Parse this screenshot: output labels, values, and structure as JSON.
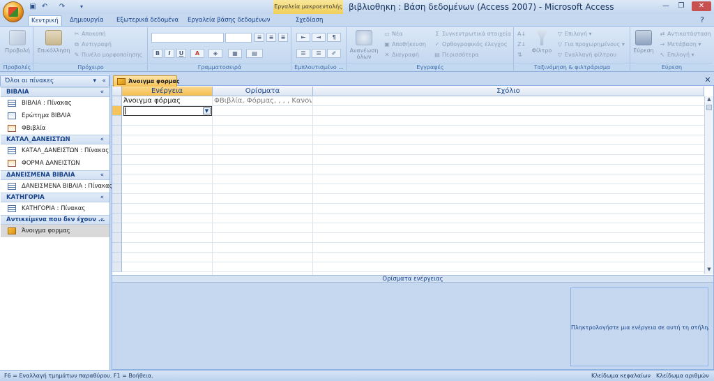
{
  "title_bar": {
    "context_tools": "Εργαλεία μακροεντολής",
    "window_title": "βιβλιοθηκη : Βάση δεδομένων (Access 2007) - Microsoft Access"
  },
  "ribbon_tabs": [
    {
      "label": "Κεντρική",
      "active": true
    },
    {
      "label": "Δημιουργία"
    },
    {
      "label": "Εξωτερικά δεδομένα"
    },
    {
      "label": "Εργαλεία βάσης δεδομένων"
    },
    {
      "label": "Σχεδίαση",
      "contextual": true
    }
  ],
  "ribbon": {
    "views": {
      "label": "Προβολές",
      "view_button": "Προβολή"
    },
    "clipboard": {
      "label": "Πρόχειρο",
      "paste": "Επικόλληση",
      "cut": "Αποκοπή",
      "copy": "Αντιγραφή",
      "format_painter": "Πινέλο μορφοποίησης"
    },
    "font": {
      "label": "Γραμματοσειρά",
      "bold": "B",
      "italic": "I",
      "underline": "U"
    },
    "rich_text": {
      "label": "Εμπλουτισμένο ..."
    },
    "records": {
      "label": "Εγγραφές",
      "refresh": "Ανανέωση",
      "refresh_sub": "όλων",
      "new": "Νέα",
      "save": "Αποθήκευση",
      "delete": "Διαγραφή",
      "totals": "Συγκεντρωτικά στοιχεία",
      "spelling": "Ορθογραφικός έλεγχος",
      "more": "Περισσότερα"
    },
    "sort_filter": {
      "label": "Ταξινόμηση & φιλτράρισμα",
      "filter": "Φίλτρο",
      "selection": "Επιλογή",
      "advanced": "Για προχωρημένους",
      "toggle": "Εναλλαγή φίλτρου"
    },
    "find": {
      "label": "Εύρεση",
      "find": "Εύρεση",
      "replace": "Αντικατάσταση",
      "goto": "Μετάβαση",
      "select": "Επιλογή"
    }
  },
  "nav": {
    "header": "Όλοι οι πίνακες",
    "groups": [
      {
        "title": "ΒΙΒΛΙΑ",
        "items": [
          {
            "label": "ΒΙΒΛΙΑ : Πίνακας",
            "icon": "table-icon"
          },
          {
            "label": "Ερώτημα ΒΙΒΛΙΑ",
            "icon": "query-icon"
          },
          {
            "label": "ΦΒιβλία",
            "icon": "form-icon"
          }
        ]
      },
      {
        "title": "ΚΑΤΑΛ_ΔΑΝΕΙΣΤΩΝ",
        "items": [
          {
            "label": "ΚΑΤΑΛ_ΔΑΝΕΙΣΤΩΝ : Πίνακας",
            "icon": "table-icon"
          },
          {
            "label": "ΦΟΡΜΑ ΔΑΝΕΙΣΤΩΝ",
            "icon": "form-icon"
          }
        ]
      },
      {
        "title": "ΔΑΝΕΙΣΜΕΝΑ ΒΙΒΛΙΑ",
        "items": [
          {
            "label": "ΔΑΝΕΙΣΜΕΝΑ ΒΙΒΛΙΑ : Πίνακας",
            "icon": "table-icon"
          }
        ]
      },
      {
        "title": "ΚΑΤΗΓΟΡΙΑ",
        "items": [
          {
            "label": "ΚΑΤΗΓΟΡΙΑ : Πίνακας",
            "icon": "table-icon"
          }
        ]
      },
      {
        "title": "Αντικείμενα που δεν έχουν ...",
        "items": [
          {
            "label": "Άνοιγμα φορμας",
            "icon": "macro-icon",
            "selected": true
          }
        ]
      }
    ]
  },
  "document": {
    "tab_label": "Άνοιγμα φορμας",
    "columns": [
      "Ενέργεια",
      "Ορίσματα",
      "Σχόλιο"
    ],
    "rows": [
      {
        "action": "Άνοιγμα φόρμας",
        "arguments": "ΦΒιβλία, Φόρμας, , , , Κανον",
        "comment": ""
      }
    ],
    "args_title": "Ορίσματα ενέργειας",
    "help_text": "Πληκτρολογήστε μια ενέργεια σε αυτή τη στήλη."
  },
  "status_bar": {
    "left": "F6 = Εναλλαγή τμημάτων παραθύρου.  F1 = Βοήθεια.",
    "caps": "Κλείδωμα κεφαλαίων",
    "num": "Κλείδωμα αριθμών"
  }
}
